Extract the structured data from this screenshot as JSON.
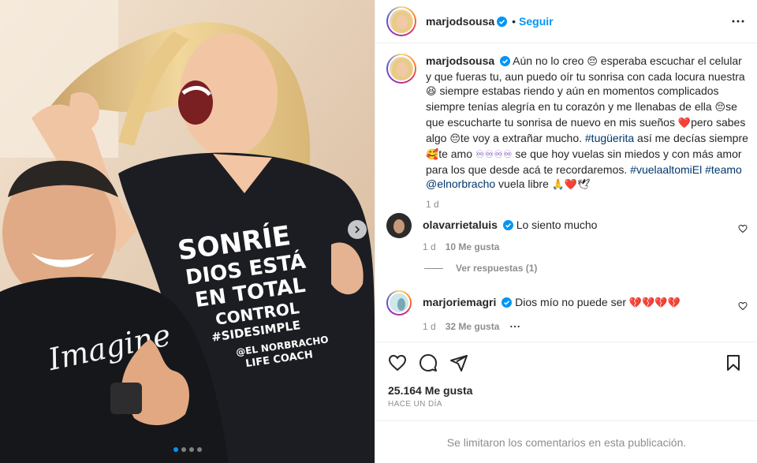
{
  "post": {
    "author": "marjodsousa",
    "follow_label": "Seguir",
    "bullet": "•",
    "image_text": {
      "shirt_woman": [
        "SONRÍE",
        "DIOS ESTÁ",
        "EN TOTAL",
        "CONTROL",
        "#SIDESIMPLE",
        "@EL NORBRACHO",
        "LIFE COACH"
      ],
      "shirt_man": "Imagine"
    },
    "carousel": {
      "count": 4,
      "active": 0
    }
  },
  "caption": {
    "username": "marjodsousa",
    "parts": [
      {
        "t": "Aún no lo creo "
      },
      {
        "e": "😔"
      },
      {
        "t": " esperaba escuchar el celular y que fueras tu, aun puedo oír tu sonrisa con cada locura nuestra "
      },
      {
        "e": "😆"
      },
      {
        "t": " siempre estabas riendo y aún en momentos complicados siempre tenías alegría en tu corazón y me llenabas de ella "
      },
      {
        "e": "😔"
      },
      {
        "t": "se que escucharte tu sonrisa de nuevo en mis sueños "
      },
      {
        "e": "❤️"
      },
      {
        "t": "pero sabes algo "
      },
      {
        "e": "😔"
      },
      {
        "t": "te voy a extrañar mucho. "
      },
      {
        "tag": "#tugüerita"
      },
      {
        "t": " así me decías siempre "
      },
      {
        "e": "🥰"
      },
      {
        "t": "te amo "
      },
      {
        "e": "♾♾♾♾"
      },
      {
        "t": " se que hoy vuelas sin miedos y con más amor para los que desde acá te recordaremos. "
      },
      {
        "tag": "#vuelaaltomiEl"
      },
      {
        "t": " "
      },
      {
        "tag": "#teamo"
      },
      {
        "t": " "
      },
      {
        "tag": "@elnorbracho"
      },
      {
        "t": " vuela libre "
      },
      {
        "e": "🙏❤️🕊"
      }
    ],
    "time": "1 d"
  },
  "comments": [
    {
      "username": "olavarrietaluis",
      "text": "Lo siento mucho",
      "time": "1 d",
      "likes": "10 Me gusta",
      "replies": "Ver respuestas (1)"
    },
    {
      "username": "marjoriemagri",
      "text": "Dios mío no puede ser ",
      "emoji": "💔💔💔💔",
      "time": "1 d",
      "likes": "32 Me gusta"
    }
  ],
  "footer": {
    "likes": "25.164 Me gusta",
    "ago": "HACE UN DÍA",
    "limited": "Se limitaron los comentarios en esta publicación."
  },
  "colors": {
    "link": "#0095f6",
    "hashtag": "#00376b",
    "muted": "#8e8e8e",
    "verified": "#0095f6"
  }
}
